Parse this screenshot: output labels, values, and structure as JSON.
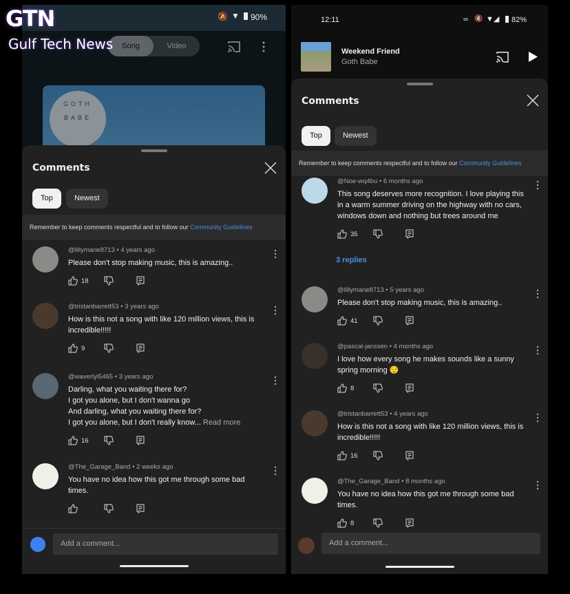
{
  "watermark": {
    "logo": "GTN",
    "name": "Gulf Tech News"
  },
  "left": {
    "status": {
      "time_fragment": "6",
      "battery": "90%"
    },
    "toggle": {
      "song": "Song",
      "video": "Video"
    },
    "album_text": "GOTH BABE",
    "sheet": {
      "title": "Comments",
      "chips": [
        "Top",
        "Newest"
      ],
      "banner": "Remember to keep comments respectful and to follow our ",
      "banner_link": "Community Guidelines",
      "input_placeholder": "Add a comment..."
    },
    "comments": [
      {
        "handle": "@lillymarie8713",
        "time": "4 years ago",
        "text": "Please don't stop making music, this is amazing..",
        "likes": "18",
        "avatar": "#8a8a86"
      },
      {
        "handle": "@tristanbarrett53",
        "time": "3 years ago",
        "text": "How is this not a song with like 120 million views, this is incredible!!!!!",
        "likes": "9",
        "avatar": "#4a3a2e"
      },
      {
        "handle": "@waverlyl5465",
        "time": "3 years ago",
        "text": "Darling, what you waiting there for?\nI got you alone, but I don't wanna go\nAnd darling, what you waiting there for?\nI got you alone, but I don't really know...",
        "read_more": "Read more",
        "likes": "16",
        "avatar": "#5a6670"
      },
      {
        "handle": "@The_Garage_Band",
        "time": "2 weeks ago",
        "text": "You have no idea how this got me through some bad times.",
        "likes": "",
        "avatar": "#f0f0e8"
      }
    ]
  },
  "right": {
    "status": {
      "time": "12:11",
      "battery": "82%"
    },
    "now_playing": {
      "title": "Weekend Friend",
      "artist": "Goth Babe"
    },
    "sheet": {
      "title": "Comments",
      "chips": [
        "Top",
        "Newest"
      ],
      "banner": "Remember to keep comments respectful and to follow our ",
      "banner_link": "Community Guidelines",
      "input_placeholder": "Add a comment..."
    },
    "replies_label": "3 replies",
    "comments": [
      {
        "handle": "@Noe-wq4bu",
        "time": "6 months ago",
        "text": "This song deserves more recognition. I love playing this in a warm summer driving on the highway with no cars, windows down and nothing but trees around me",
        "likes": "35",
        "avatar": "#bcd8ea"
      },
      {
        "handle": "@lillymarie8713",
        "time": "5 years ago",
        "text": "Please don't stop making music, this is amazing..",
        "likes": "41",
        "avatar": "#8a8a86"
      },
      {
        "handle": "@pascal-janssen",
        "time": "4 months ago",
        "text": "I love how every song he makes sounds like a sunny spring morning 😌",
        "likes": "8",
        "avatar": "#3a302a"
      },
      {
        "handle": "@tristanbarrett53",
        "time": "4 years ago",
        "text": "How is this not a song with like 120 million views, this is incredible!!!!!",
        "likes": "16",
        "avatar": "#4a3a2e"
      },
      {
        "handle": "@The_Garage_Band",
        "time": "8 months ago",
        "text": "You have no idea how this got me through some bad times.",
        "likes": "8",
        "avatar": "#f0f0e8"
      }
    ]
  },
  "colors": {
    "accent": "#4a8fe8",
    "sheet": "#212121"
  }
}
